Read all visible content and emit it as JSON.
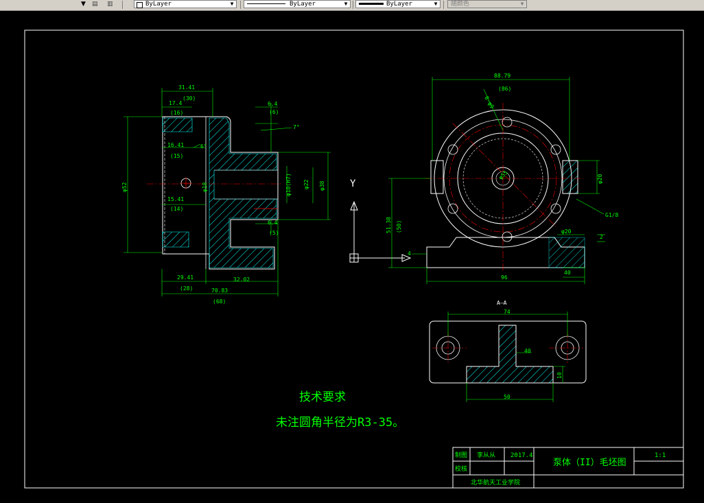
{
  "toolbar": {
    "color_combo": "ByLayer",
    "linetype_combo": "ByLayer",
    "lineweight_combo": "ByLayer",
    "plotstyle_combo": "随颜色"
  },
  "drawing": {
    "side_view": {
      "dims": [
        "31.41",
        "(30)",
        "17.4",
        "(16)",
        "16.41",
        "(15)",
        "15.41",
        "(14)",
        "29.41",
        "(28)",
        "32.02",
        "70.83",
        "(68)",
        "6.4",
        "(6)",
        "6.4",
        "(5)",
        "7°",
        "6°"
      ],
      "diameters": [
        "φ52",
        "φ18",
        "φ22",
        "φ38",
        "φ10(H7)"
      ]
    },
    "front_view": {
      "dims": [
        "88.79",
        "(86)",
        "51.38",
        "(50)",
        "96",
        "40",
        "4",
        "2"
      ],
      "diameters": [
        "φ20",
        "φ20",
        "φ55",
        "G1/8",
        "8-φ9"
      ],
      "axis_y": "Y"
    },
    "section_view": {
      "title": "A—A",
      "dims": [
        "74",
        "40",
        "10",
        "50"
      ]
    },
    "notes": {
      "heading": "技术要求",
      "line1": "未注圆角半径为R3-35。"
    },
    "title_block": {
      "drafter_label": "制图",
      "drafter_name": "李从从",
      "date": "2017.4",
      "checker_label": "校核",
      "part_title": "泵体（II）毛坯图",
      "scale": "1:1",
      "school": "北华航天工业学院"
    }
  },
  "colors": {
    "background": "#000000",
    "border": "#ffffff",
    "dimension": "#00ff00",
    "hatch": "#00ffff",
    "geometry": "#ffffff",
    "accent": "#ff0000",
    "notes": "#00ff00"
  }
}
